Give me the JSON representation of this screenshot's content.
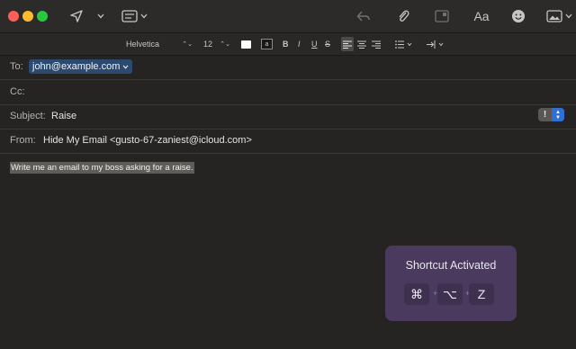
{
  "toolbar": {
    "send_icon": "paper-plane-icon",
    "header_fields_icon": "header-fields-icon",
    "reply_icon": "reply-icon",
    "attach_icon": "paperclip-icon",
    "format_icon": "Aa",
    "emoji_icon": "emoji-icon",
    "photo_icon": "photo-browser-icon"
  },
  "format": {
    "font": "Helvetica",
    "size": "12",
    "bold": "B",
    "italic": "I",
    "underline": "U",
    "strike": "S"
  },
  "headers": {
    "to_label": "To:",
    "to_value": "john@example.com",
    "cc_label": "Cc:",
    "subject_label": "Subject:",
    "subject_value": "Raise",
    "from_label": "From:",
    "from_value": "Hide My Email <gusto-67-zaniest@icloud.com>",
    "priority": "!"
  },
  "body": {
    "text": "Write me an email to my boss asking for a raise."
  },
  "toast": {
    "title": "Shortcut Activated",
    "keys": [
      "⌘",
      "⌥",
      "Z"
    ],
    "separator": "+"
  },
  "colors": {
    "background": "#262422",
    "chip": "#2c4a70",
    "toast": "#4a3a5e",
    "accent": "#2f6fd6"
  }
}
